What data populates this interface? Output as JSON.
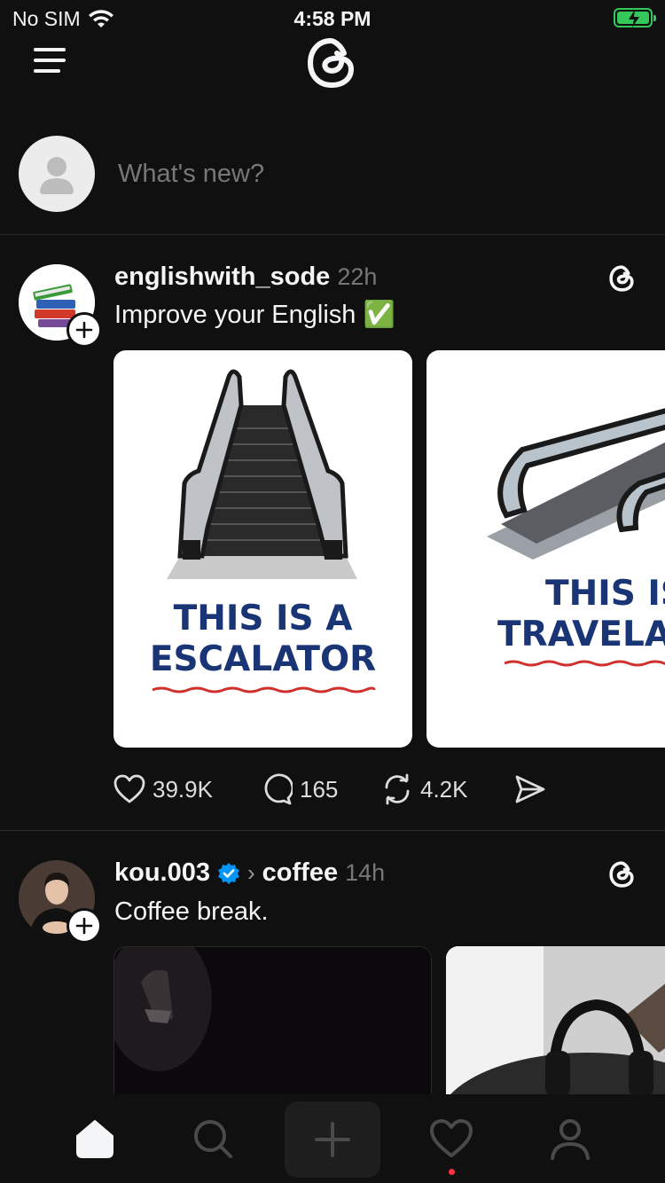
{
  "status": {
    "carrier": "No SIM",
    "time": "4:58 PM"
  },
  "composer": {
    "placeholder": "What's new?"
  },
  "posts": [
    {
      "username": "englishwith_sode",
      "time": "22h",
      "text": "Improve your English ✅",
      "cards": [
        {
          "caption_line1": "THIS IS A",
          "caption_line2": "ESCALATOR"
        },
        {
          "caption_line1": "THIS IS",
          "caption_line2": "TRAVELAT"
        }
      ],
      "stats": {
        "likes": "39.9K",
        "replies": "165",
        "reposts": "4.2K"
      }
    },
    {
      "username": "kou.003",
      "topic": "coffee",
      "time": "14h",
      "text": "Coffee break."
    }
  ],
  "colors": {
    "background": "#101010",
    "accent_battery": "#34c759",
    "notification": "#ff3040",
    "verified": "#0095f6",
    "caption_blue": "#1a3575"
  }
}
